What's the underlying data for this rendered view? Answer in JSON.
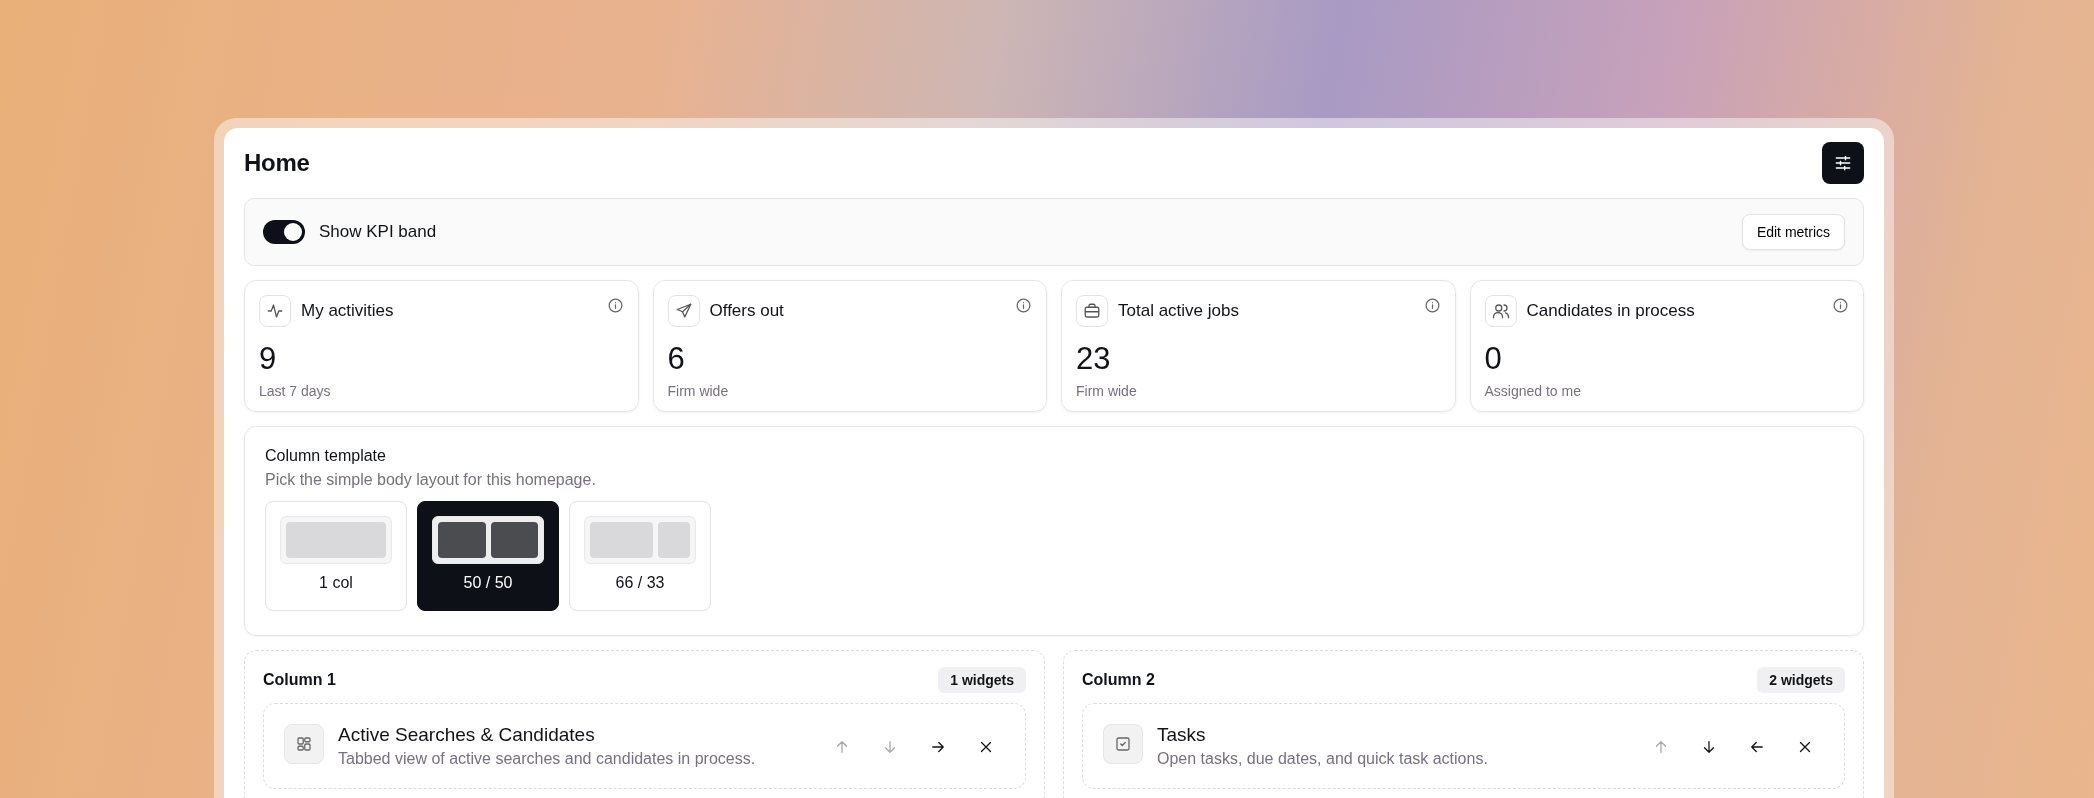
{
  "page": {
    "title": "Home"
  },
  "kpi_band": {
    "toggle_label": "Show KPI band",
    "on": true,
    "edit_button": "Edit metrics"
  },
  "metrics": [
    {
      "title": "My activities",
      "value": "9",
      "caption": "Last 7 days"
    },
    {
      "title": "Offers out",
      "value": "6",
      "caption": "Firm wide"
    },
    {
      "title": "Total active jobs",
      "value": "23",
      "caption": "Firm wide"
    },
    {
      "title": "Candidates in process",
      "value": "0",
      "caption": "Assigned to me"
    }
  ],
  "column_template": {
    "title": "Column template",
    "subtitle": "Pick the simple body layout for this homepage.",
    "options": [
      {
        "label": "1 col",
        "kind": "single",
        "selected": false
      },
      {
        "label": "50 / 50",
        "kind": "even",
        "selected": true
      },
      {
        "label": "66 / 33",
        "kind": "wide",
        "selected": false
      }
    ]
  },
  "columns": [
    {
      "title": "Column 1",
      "badge": "1 widgets",
      "widgets": [
        {
          "title": "Active Searches & Candidates",
          "description": "Tabbed view of active searches and candidates in process.",
          "actions": [
            {
              "kind": "up",
              "disabled": true
            },
            {
              "kind": "down",
              "disabled": true
            },
            {
              "kind": "right",
              "disabled": false
            },
            {
              "kind": "remove",
              "disabled": false
            }
          ]
        }
      ]
    },
    {
      "title": "Column 2",
      "badge": "2 widgets",
      "widgets": [
        {
          "title": "Tasks",
          "description": "Open tasks, due dates, and quick task actions.",
          "actions": [
            {
              "kind": "up",
              "disabled": true
            },
            {
              "kind": "down",
              "disabled": false
            },
            {
              "kind": "left",
              "disabled": false
            },
            {
              "kind": "remove",
              "disabled": false
            }
          ]
        }
      ]
    }
  ]
}
